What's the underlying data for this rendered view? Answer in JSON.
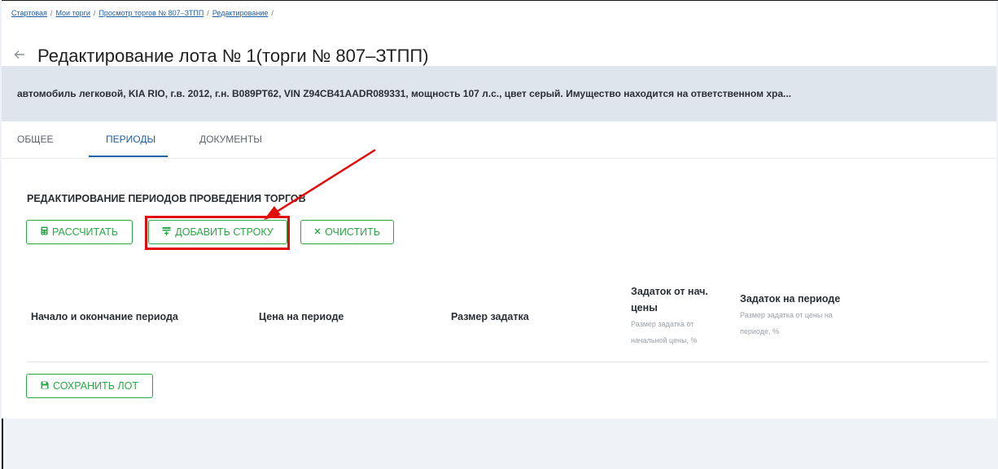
{
  "breadcrumb": {
    "items": [
      "Стартовая",
      "Мои торги",
      "Просмотр торгов № 807–ЗТПП",
      "Редактирование"
    ],
    "separator": "/"
  },
  "page": {
    "back_icon": "arrow-left-icon",
    "title": "Редактирование лота № 1(торги № 807–ЗТПП)"
  },
  "lot": {
    "description": "автомобиль легковой, KIA RIO, г.в. 2012, г.н. В089РТ62, VIN Z94CB41AADR089331, мощность 107 л.с., цвет серый. Имущество находится на ответственном хра..."
  },
  "tabs": [
    {
      "label": "ОБЩЕЕ",
      "active": false
    },
    {
      "label": "ПЕРИОДЫ",
      "active": true
    },
    {
      "label": "ДОКУМЕНТЫ",
      "active": false
    }
  ],
  "section": {
    "title": "РЕДАКТИРОВАНИЕ ПЕРИОДОВ ПРОВЕДЕНИЯ ТОРГОВ"
  },
  "toolbar": {
    "calculate_label": "РАССЧИТАТЬ",
    "calculate_icon": "calculator-icon",
    "add_row_label": "ДОБАВИТЬ СТРОКУ",
    "add_row_icon": "add-row-icon",
    "clear_label": "ОЧИСТИТЬ",
    "clear_icon": "close-icon"
  },
  "table": {
    "columns": [
      {
        "label": "Начало и окончание периода",
        "sub": ""
      },
      {
        "label": "Цена на периоде",
        "sub": ""
      },
      {
        "label": "Размер задатка",
        "sub": ""
      },
      {
        "label": "Задаток от нач. цены",
        "sub": "Размер задатка от начальной цены, %"
      },
      {
        "label": "Задаток на периоде",
        "sub": "Размер задатка от цены на периоде, %"
      }
    ]
  },
  "footer": {
    "save_label": "СОХРАНИТЬ ЛОТ",
    "save_icon": "save-icon"
  },
  "colors": {
    "accent_green": "#28a745",
    "link_blue": "#1f5fa8",
    "annotation_red": "#e30b0b",
    "bar_gray": "#dfe5ec"
  }
}
